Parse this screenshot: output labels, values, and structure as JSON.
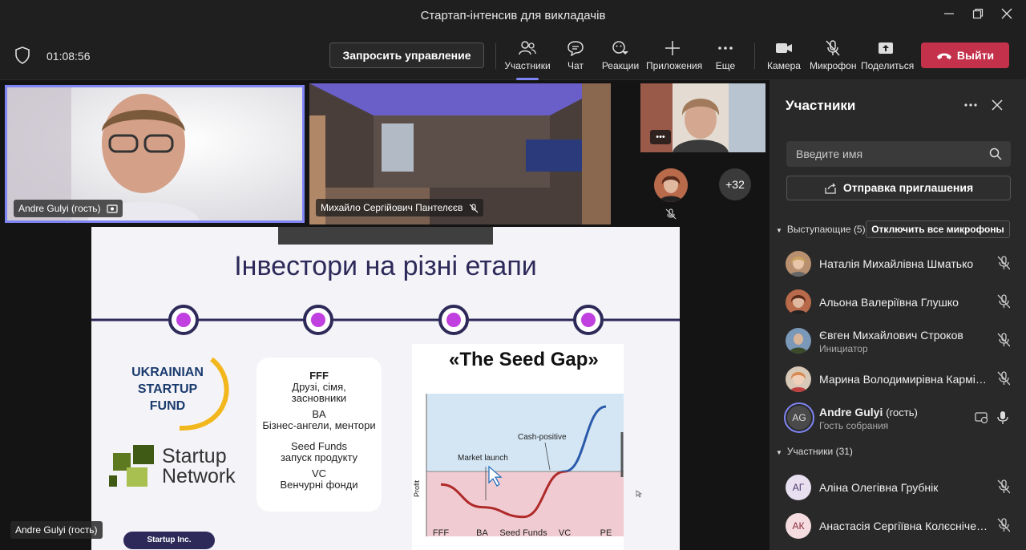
{
  "window": {
    "title": "Стартап-інтенсив для викладачів"
  },
  "toolbar": {
    "timer": "01:08:56",
    "request_control": "Запросить управление",
    "participants": "Участники",
    "chat": "Чат",
    "reactions": "Реакции",
    "apps": "Приложения",
    "more": "Еще",
    "camera": "Камера",
    "mic": "Микрофон",
    "share": "Поделиться",
    "leave": "Выйти"
  },
  "videos": {
    "tile1_name": "Andre Gulyi (гость)",
    "tile2_name": "Михайло Сергійович Пантелєєв",
    "overflow_count": "+32",
    "tile3_more": "•••",
    "presenter_label": "Andre Gulyi (гость)"
  },
  "slide": {
    "title": "Інвестори на різні етапи",
    "usf_line1": "UKRAINIAN",
    "usf_line2": "STARTUP",
    "usf_line3": "FUND",
    "sn_line1": "Startup",
    "sn_line2": "Network",
    "box_fff": "FFF",
    "box_fff_desc1": "Друзі, сімя,",
    "box_fff_desc2": "засновники",
    "box_ba": "BA",
    "box_ba_desc": "Бізнес-ангели, ментори",
    "box_seed": "Seed Funds",
    "box_seed_desc": "запуск продукту",
    "box_vc": "VC",
    "box_vc_desc": "Венчурні фонди",
    "chart_title": "«The Seed Gap»",
    "startup_inc": "Startup Inc."
  },
  "chart_data": {
    "type": "line",
    "title": "«The Seed Gap»",
    "ylabel": "Profit",
    "xlabel": "",
    "categories": [
      "FFF",
      "BA",
      "Seed Funds",
      "VC",
      "PE"
    ],
    "annotations": [
      "Market launch",
      "Cash-positive"
    ],
    "series": [
      {
        "values": [
          -0.2,
          -0.55,
          -0.7,
          0.0,
          1.0
        ]
      }
    ]
  },
  "panel": {
    "title": "Участники",
    "search_placeholder": "Введите имя",
    "invite": "Отправка приглашения",
    "speakers_header": "Выступающие (5)",
    "mute_all": "Отключить все микрофоны",
    "speakers": [
      {
        "name": "Наталія Михайлівна Шматько",
        "sub": ""
      },
      {
        "name": "Альона Валеріївна Глушко",
        "sub": ""
      },
      {
        "name": "Євген Михайлович Строков",
        "sub": "Инициатор"
      },
      {
        "name": "Марина Володимирівна Карміщева",
        "sub": ""
      },
      {
        "name": "Andre Gulyi",
        "guest": "(гость)",
        "sub": "Гость собрания",
        "initials": "AG"
      }
    ],
    "attendees_header": "Участники (31)",
    "attendees": [
      {
        "name": "Аліна Олегівна Грубнік",
        "initials": "АГ"
      },
      {
        "name": "Анастасія Сергіївна Колєсніченко",
        "initials": "АК"
      }
    ]
  },
  "colors": {
    "accent": "#7f85f5",
    "leave": "#c4314b",
    "slide_navy": "#2d2a5a",
    "dot_purple": "#c040e0"
  }
}
